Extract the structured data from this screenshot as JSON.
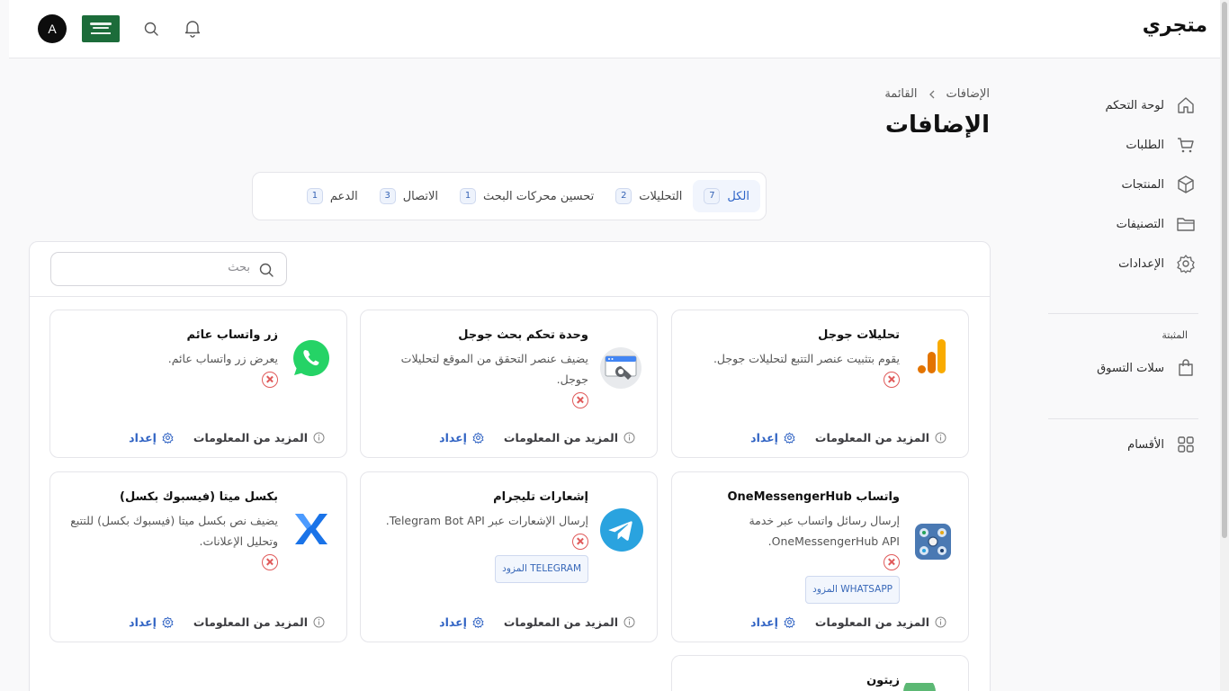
{
  "app": {
    "brand": "متجري",
    "avatar_initial": "A"
  },
  "header": {
    "icons": [
      "bell-icon",
      "search-icon"
    ]
  },
  "sidebar": {
    "items": [
      {
        "label": "لوحة التحكم",
        "icon": "home-icon"
      },
      {
        "label": "الطلبات",
        "icon": "cart-icon"
      },
      {
        "label": "المنتجات",
        "icon": "box-icon"
      },
      {
        "label": "التصنيفات",
        "icon": "folder-icon"
      },
      {
        "label": "الإعدادات",
        "icon": "gear-icon"
      }
    ],
    "pinned_heading": "المثبتة",
    "pinned_items": [
      {
        "label": "سلات التسوق",
        "icon": "bag-icon"
      }
    ],
    "sections_item": {
      "label": "الأقسام",
      "icon": "grid-icon"
    }
  },
  "breadcrumb": {
    "root": "الإضافات",
    "current": "القائمة"
  },
  "page_title": "الإضافات",
  "tabs": [
    {
      "label": "الكل",
      "count": "7",
      "active": true
    },
    {
      "label": "التحليلات",
      "count": "2"
    },
    {
      "label": "تحسين محركات البحث",
      "count": "1"
    },
    {
      "label": "الاتصال",
      "count": "3"
    },
    {
      "label": "الدعم",
      "count": "1"
    }
  ],
  "search": {
    "placeholder": "بحث"
  },
  "card_actions": {
    "more": "المزيد من المعلومات",
    "setup": "إعداد"
  },
  "plugins": [
    {
      "title": "تحليلات جوجل",
      "desc": "يقوم بتثبيت عنصر التتبع لتحليلات جوجل.",
      "icon": "google-analytics-icon"
    },
    {
      "title": "وحدة تحكم بحث جوجل",
      "desc": "يضيف عنصر التحقق من الموقع لتحليلات جوجل.",
      "icon": "search-console-icon"
    },
    {
      "title": "زر واتساب عائم",
      "desc": "يعرض زر واتساب عائم.",
      "icon": "whatsapp-icon"
    },
    {
      "title": "واتساب OneMessengerHub",
      "desc": "إرسال رسائل واتساب عبر خدمة OneMessengerHub API.",
      "provider": "WHATSAPP المزود",
      "icon": "onemessengerhub-icon"
    },
    {
      "title": "إشعارات تليجرام",
      "desc": "إرسال الإشعارات عبر Telegram Bot API.",
      "provider": "TELEGRAM المزود",
      "icon": "telegram-icon"
    },
    {
      "title": "بكسل ميتا (فيسبوك بكسل)",
      "desc": "يضيف نص بكسل ميتا (فيسبوك بكسل) للتتبع وتحليل الإعلانات.",
      "icon": "meta-icon"
    },
    {
      "title": "زيتون",
      "icon": "zaytoon-icon"
    }
  ],
  "colors": {
    "accent": "#2f65c8",
    "danger": "#e05a5a",
    "whatsapp": "#25d366",
    "telegram": "#2aa3df"
  }
}
